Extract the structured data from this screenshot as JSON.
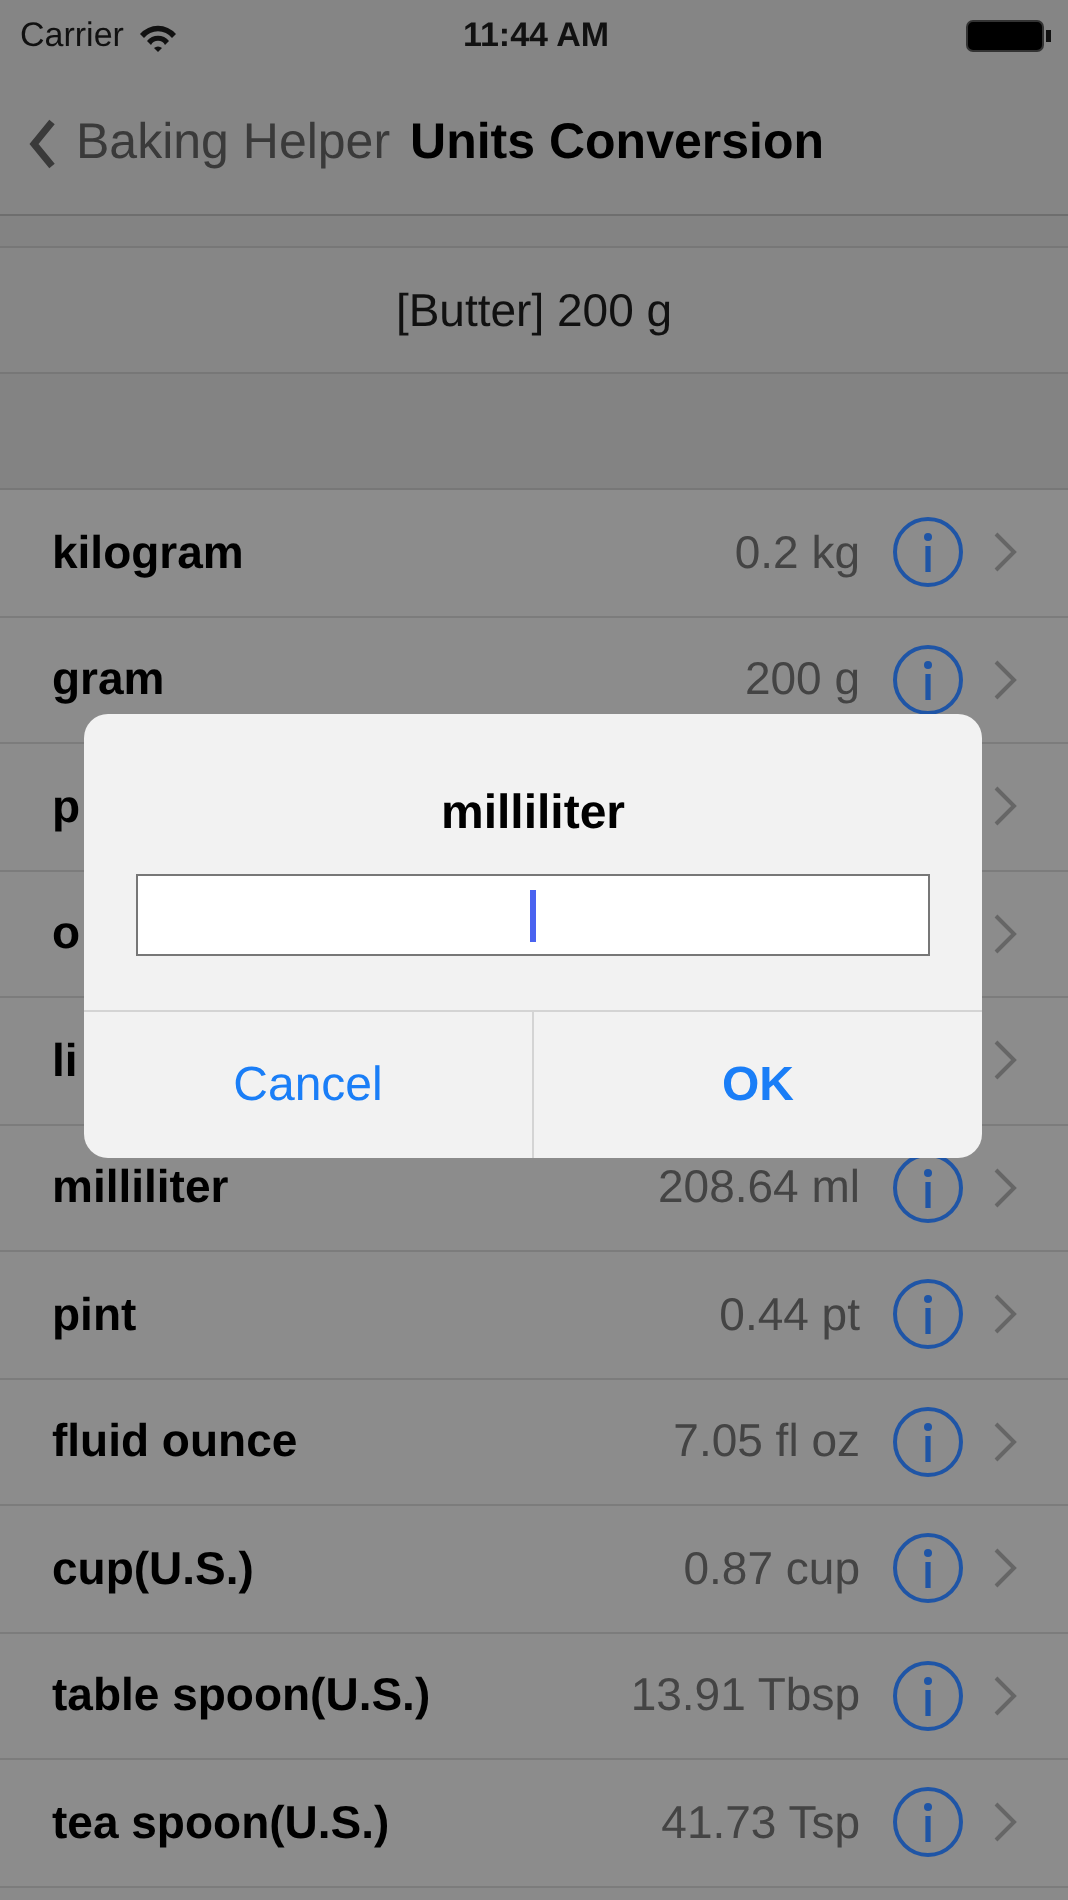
{
  "status_bar": {
    "carrier": "Carrier",
    "time": "11:44 AM"
  },
  "nav_bar": {
    "back": "Baking Helper",
    "title": "Units Conversion"
  },
  "ingredient": "[Butter] 200 g",
  "units": [
    {
      "kind": "full",
      "name": "kilogram",
      "value": "0.2 kg"
    },
    {
      "kind": "full",
      "name": "gram",
      "value": "200 g"
    },
    {
      "kind": "covered",
      "name": "p"
    },
    {
      "kind": "covered",
      "name": "o"
    },
    {
      "kind": "covered",
      "name": "li"
    },
    {
      "kind": "full",
      "name": "milliliter",
      "value": "208.64 ml"
    },
    {
      "kind": "full",
      "name": "pint",
      "value": "0.44 pt"
    },
    {
      "kind": "full",
      "name": "fluid ounce",
      "value": "7.05 fl oz"
    },
    {
      "kind": "full",
      "name": "cup(U.S.)",
      "value": "0.87 cup"
    },
    {
      "kind": "full",
      "name": "table spoon(U.S.)",
      "value": "13.91 Tbsp"
    },
    {
      "kind": "full",
      "name": "tea spoon(U.S.)",
      "value": "41.73 Tsp"
    }
  ],
  "alert": {
    "title": "milliliter",
    "buttons": [
      "Cancel",
      "OK"
    ]
  }
}
